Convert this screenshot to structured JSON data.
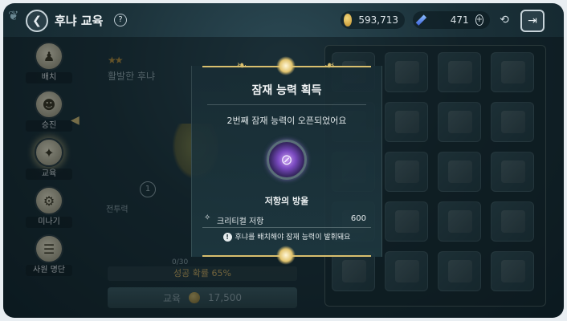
{
  "header": {
    "title": "후냐 교육",
    "help_icon": "question-icon",
    "gold": "593,713",
    "gems": "471"
  },
  "sidebar": {
    "items": [
      {
        "label": "배치",
        "icon": "deploy-icon"
      },
      {
        "label": "승진",
        "icon": "promotion-icon"
      },
      {
        "label": "교육",
        "icon": "education-icon"
      },
      {
        "label": "미나기",
        "icon": "settings-gear-icon"
      },
      {
        "label": "사원 명단",
        "icon": "roster-icon"
      }
    ],
    "active_index": 2
  },
  "background": {
    "character_name": "활발한 후냐",
    "stat_label": "전투력",
    "stat_badge": "1",
    "progress": "0/30",
    "success_rate": "성공 확률 65%",
    "edu_button": {
      "label": "교육",
      "cost": "17,500"
    }
  },
  "modal": {
    "title": "잠재 능력 획득",
    "subtitle": "2번째 잠재 능력이 오픈되었어요",
    "ability_icon": "resistance-orb-icon",
    "ability_name": "저항의 방울",
    "stat": {
      "name": "크리티컬 저항",
      "value": "600"
    },
    "notice": "후냐를 배치해야 잠재 능력이 발휘돼요"
  },
  "colors": {
    "accent_gold": "#d9bf6e",
    "panel_bg": "#1b3139"
  }
}
